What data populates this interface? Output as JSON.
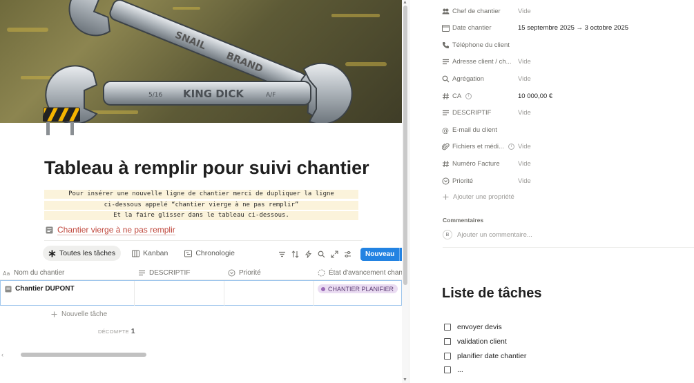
{
  "page": {
    "title": "Tableau à remplir pour suivi chantier",
    "callout_lines": [
      "Pour insérer une nouvelle ligne de chantier merci de dupliquer la ligne",
      "ci-dessous appelé “chantier vierge à ne pas remplir”",
      "Et la faire glisser dans le tableau ci-dessous."
    ],
    "template_link": "Chantier vierge à ne pas remplir"
  },
  "views": {
    "tabs": [
      {
        "label": "Toutes les tâches",
        "icon": "asterisk-icon",
        "active": true
      },
      {
        "label": "Kanban",
        "icon": "board-icon",
        "active": false
      },
      {
        "label": "Chronologie",
        "icon": "timeline-icon",
        "active": false
      }
    ],
    "new_button": "Nouveau"
  },
  "table": {
    "columns": [
      {
        "label": "Nom du chantier",
        "icon": "text-icon"
      },
      {
        "label": "DESCRIPTIF",
        "icon": "lines-icon"
      },
      {
        "label": "Priorité",
        "icon": "select-icon"
      },
      {
        "label": "État d'avancement chantie",
        "icon": "status-icon"
      }
    ],
    "rows": [
      {
        "name": "Chantier DUPONT",
        "descriptif": "",
        "priorite": "",
        "etat": "CHANTIER PLANIFIER"
      }
    ],
    "new_task": "Nouvelle tâche",
    "count_label": "DÉCOMPTE",
    "count_value": "1"
  },
  "properties": [
    {
      "name": "Chef de chantier",
      "icon": "people-icon",
      "value": "Vide",
      "filled": false
    },
    {
      "name": "Date chantier",
      "icon": "calendar-icon",
      "value": "15 septembre 2025 → 3 octobre 2025",
      "filled": true
    },
    {
      "name": "Téléphone du client",
      "icon": "phone-icon",
      "value": "",
      "filled": false
    },
    {
      "name": "Adresse client / ch...",
      "icon": "lines-icon",
      "value": "Vide",
      "filled": false
    },
    {
      "name": "Agrégation",
      "icon": "search-icon",
      "value": "Vide",
      "filled": false
    },
    {
      "name": "CA",
      "icon": "hash-icon",
      "value": "10 000,00 €",
      "filled": true,
      "info": true
    },
    {
      "name": "DESCRIPTIF",
      "icon": "lines-icon",
      "value": "Vide",
      "filled": false
    },
    {
      "name": "E-mail du client",
      "icon": "at-icon",
      "value": "",
      "filled": false
    },
    {
      "name": "Fichiers et médi...",
      "icon": "paperclip-icon",
      "value": "Vide",
      "filled": false,
      "info": true
    },
    {
      "name": "Numéro Facture",
      "icon": "hash-icon",
      "value": "Vide",
      "filled": false
    },
    {
      "name": "Priorité",
      "icon": "select-icon",
      "value": "Vide",
      "filled": false
    }
  ],
  "add_property": "Ajouter une propriété",
  "comments": {
    "heading": "Commentaires",
    "avatar": "B",
    "placeholder": "Ajouter un commentaire..."
  },
  "tasks": {
    "title": "Liste de tâches",
    "items": [
      "envoyer devis",
      "validation client",
      "planifier date chantier",
      "..."
    ]
  },
  "colors": {
    "accent": "#2383e2",
    "link": "#c0483d",
    "status_tag_bg": "#eadcf2",
    "callout_bg": "#fbf3db"
  }
}
